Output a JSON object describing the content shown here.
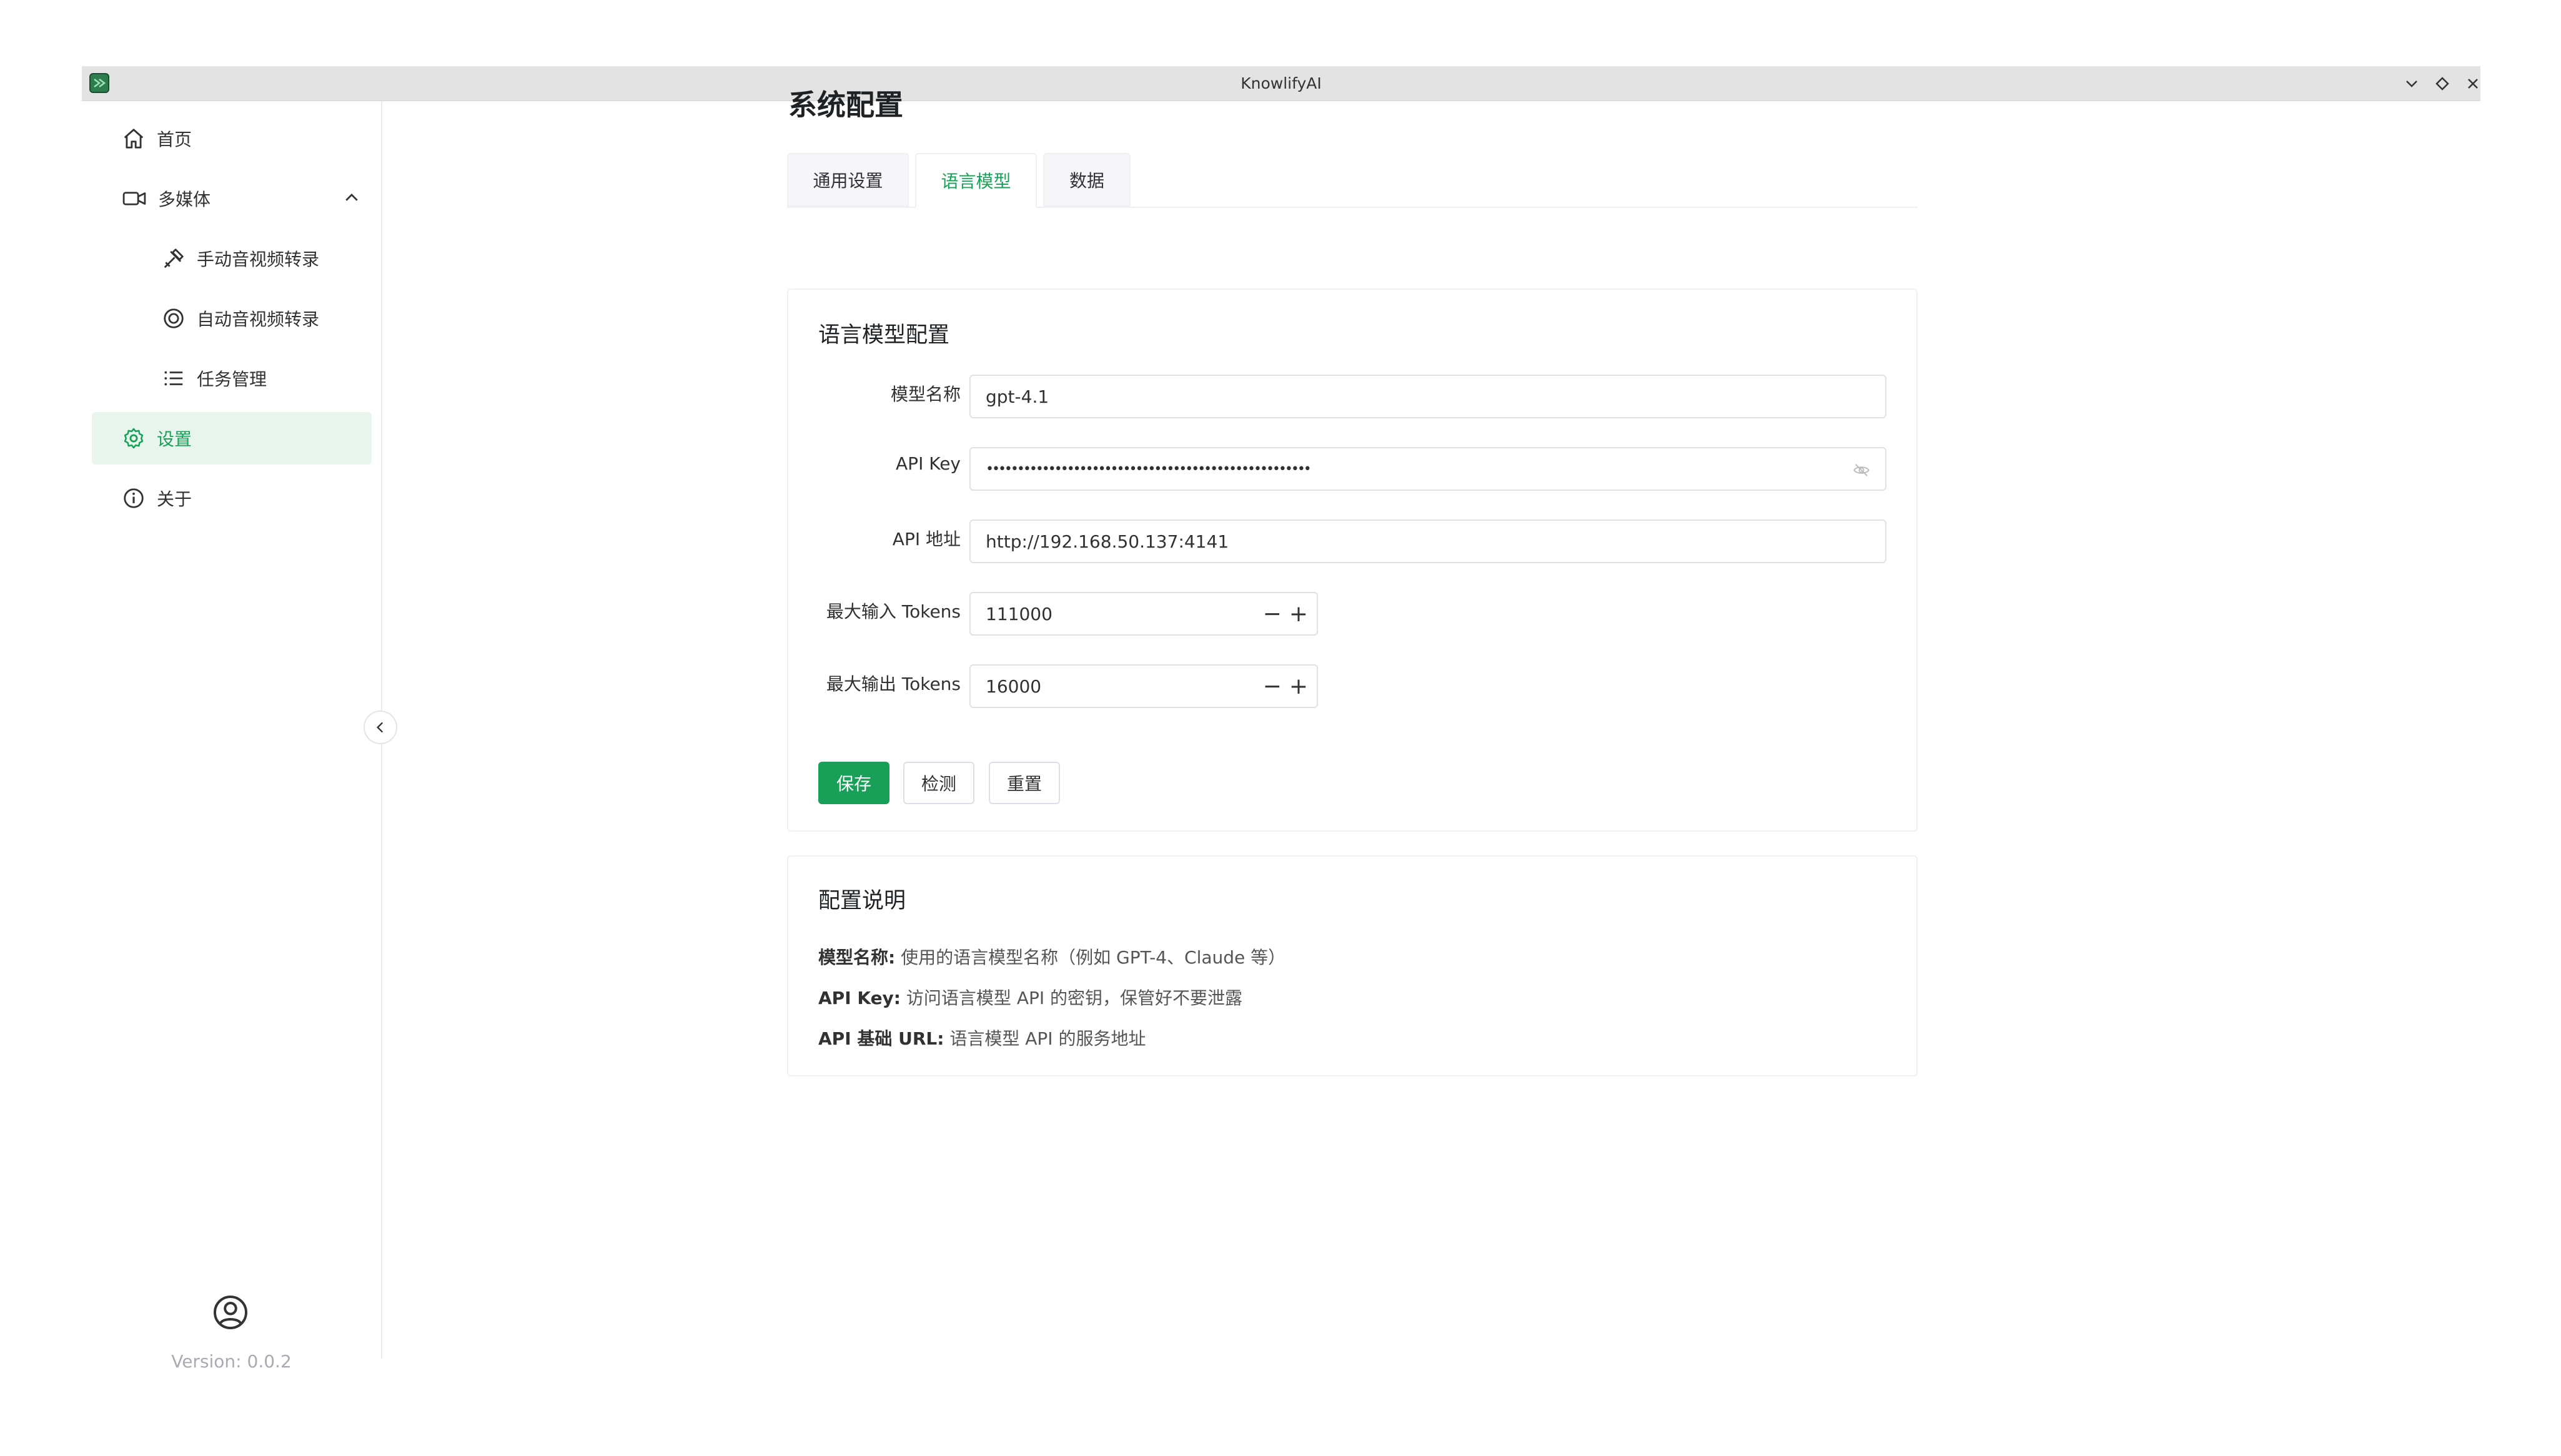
{
  "window": {
    "title": "KnowlifyAI",
    "colors": {
      "accent": "#18a058",
      "accent_bg": "#e8f5ec",
      "titlebar": "#e3e3e3"
    }
  },
  "sidebar": {
    "items": [
      {
        "label": "首页",
        "icon": "home-icon"
      },
      {
        "label": "多媒体",
        "icon": "video-camera-icon",
        "expanded": true
      },
      {
        "label": "手动音视频转录",
        "icon": "tools-icon"
      },
      {
        "label": "自动音视频转录",
        "icon": "target-icon"
      },
      {
        "label": "任务管理",
        "icon": "list-icon"
      },
      {
        "label": "设置",
        "icon": "gear-icon",
        "active": true
      },
      {
        "label": "关于",
        "icon": "info-icon"
      }
    ],
    "version": "Version: 0.0.2"
  },
  "page": {
    "title": "系统配置",
    "tabs": [
      {
        "label": "通用设置",
        "active": false
      },
      {
        "label": "语言模型",
        "active": true
      },
      {
        "label": "数据",
        "active": false
      }
    ]
  },
  "llm_card": {
    "title": "语言模型配置",
    "fields": {
      "model_name": {
        "label": "模型名称",
        "value": "gpt-4.1"
      },
      "api_key": {
        "label": "API Key",
        "value": "••••••••••••••••••••••••••••••••••••••••••••••••••••"
      },
      "api_url": {
        "label": "API 地址",
        "value": "http://192.168.50.137:4141"
      },
      "max_input": {
        "label": "最大输入 Tokens",
        "value": "111000"
      },
      "max_output": {
        "label": "最大输出 Tokens",
        "value": "16000"
      }
    },
    "buttons": {
      "save": "保存",
      "check": "检测",
      "reset": "重置"
    }
  },
  "help_card": {
    "title": "配置说明",
    "lines": [
      {
        "key": "模型名称:",
        "text": " 使用的语言模型名称（例如 GPT-4、Claude 等）"
      },
      {
        "key": "API Key:",
        "text": " 访问语言模型 API 的密钥，保管好不要泄露"
      },
      {
        "key": "API 基础 URL:",
        "text": " 语言模型 API 的服务地址"
      }
    ]
  }
}
